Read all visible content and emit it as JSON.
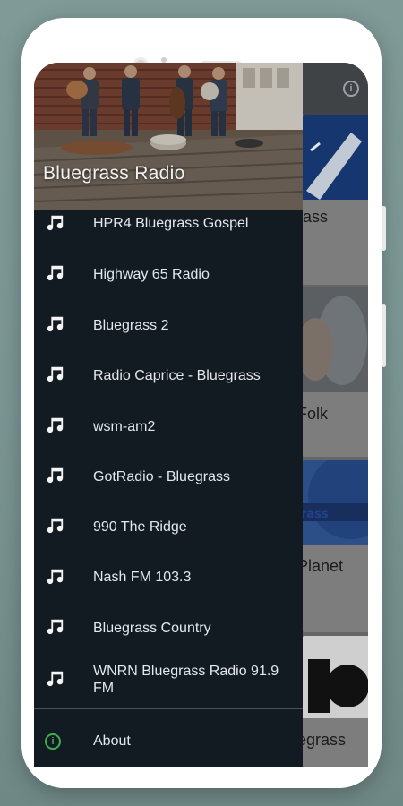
{
  "drawer": {
    "title": "Bluegrass Radio",
    "items": [
      {
        "label": "HPR4 Bluegrass Gospel",
        "icon": "music-note-icon"
      },
      {
        "label": "Highway 65 Radio",
        "icon": "music-note-icon"
      },
      {
        "label": "Bluegrass 2",
        "icon": "music-note-icon"
      },
      {
        "label": "Radio Caprice - Bluegrass",
        "icon": "music-note-icon"
      },
      {
        "label": "wsm-am2",
        "icon": "music-note-icon"
      },
      {
        "label": "GotRadio - Bluegrass",
        "icon": "music-note-icon"
      },
      {
        "label": "990 The Ridge",
        "icon": "music-note-icon"
      },
      {
        "label": "Nash FM 103.3",
        "icon": "music-note-icon"
      },
      {
        "label": "Bluegrass Country",
        "icon": "music-note-icon"
      },
      {
        "label": "WNRN Bluegrass Radio 91.9 FM",
        "icon": "music-note-icon"
      }
    ],
    "about_label": "About"
  },
  "background": {
    "cards": [
      {
        "label": "rass"
      },
      {
        "label": "Folk"
      },
      {
        "label": "Planet"
      },
      {
        "label": "egrass"
      }
    ]
  },
  "colors": {
    "drawer_bg": "#131b22",
    "accent_green": "#3fae4f",
    "text": "#e4e8ec"
  }
}
